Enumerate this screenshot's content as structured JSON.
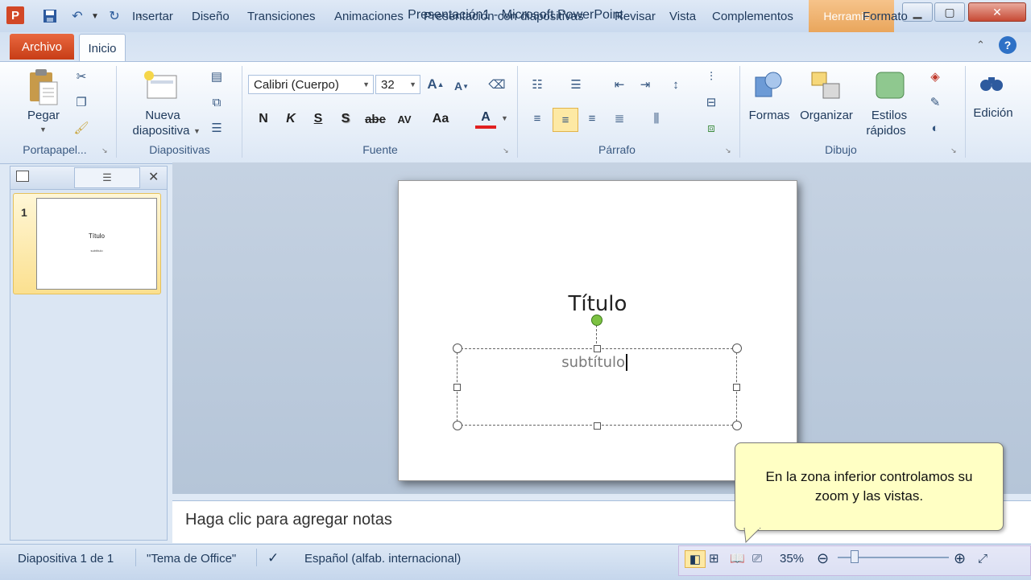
{
  "window": {
    "title": "Presentación1  -  Microsoft PowerPoint",
    "app_icon": "P",
    "context_tab": "Herramie...",
    "quick_access": [
      "save-icon",
      "undo-icon",
      "redo-icon",
      "customize-icon"
    ]
  },
  "tabs": {
    "archivo": "Archivo",
    "inicio": "Inicio",
    "items": [
      "Insertar",
      "Diseño",
      "Transiciones",
      "Animaciones",
      "Presentación con diapositivas",
      "Revisar",
      "Vista",
      "Complementos"
    ],
    "formato": "Formato"
  },
  "ribbon": {
    "portapapeles": {
      "label": "Portapapel...",
      "pegar": "Pegar"
    },
    "diapositivas": {
      "label": "Diapositivas",
      "nueva_line1": "Nueva",
      "nueva_line2": "diapositiva"
    },
    "fuente": {
      "label": "Fuente",
      "font_name": "Calibri (Cuerpo)",
      "font_size": "32",
      "bold": "N",
      "italic": "K",
      "underline": "S",
      "shadow": "S",
      "strike": "abe",
      "spacing": "AV",
      "case": "Aa",
      "font_color": "A"
    },
    "parrafo": {
      "label": "Párrafo"
    },
    "dibujo": {
      "label": "Dibujo",
      "formas": "Formas",
      "organizar": "Organizar",
      "estilos_line1": "Estilos",
      "estilos_line2": "rápidos"
    },
    "edicion": {
      "label": "Edición"
    }
  },
  "panel": {
    "slide_number": "1",
    "thumb_title": "Título",
    "thumb_subtitle": "subtítulo"
  },
  "slide": {
    "title": "Título",
    "subtitle": "subtítulo"
  },
  "notes": {
    "placeholder": "Haga clic para agregar notas"
  },
  "status": {
    "slide_info": "Diapositiva 1 de 1",
    "theme": "\"Tema de Office\"",
    "language": "Español (alfab. internacional)",
    "zoom": "35%"
  },
  "callout": {
    "line1": "En la zona inferior controlamos su",
    "line2": "zoom y las vistas."
  }
}
